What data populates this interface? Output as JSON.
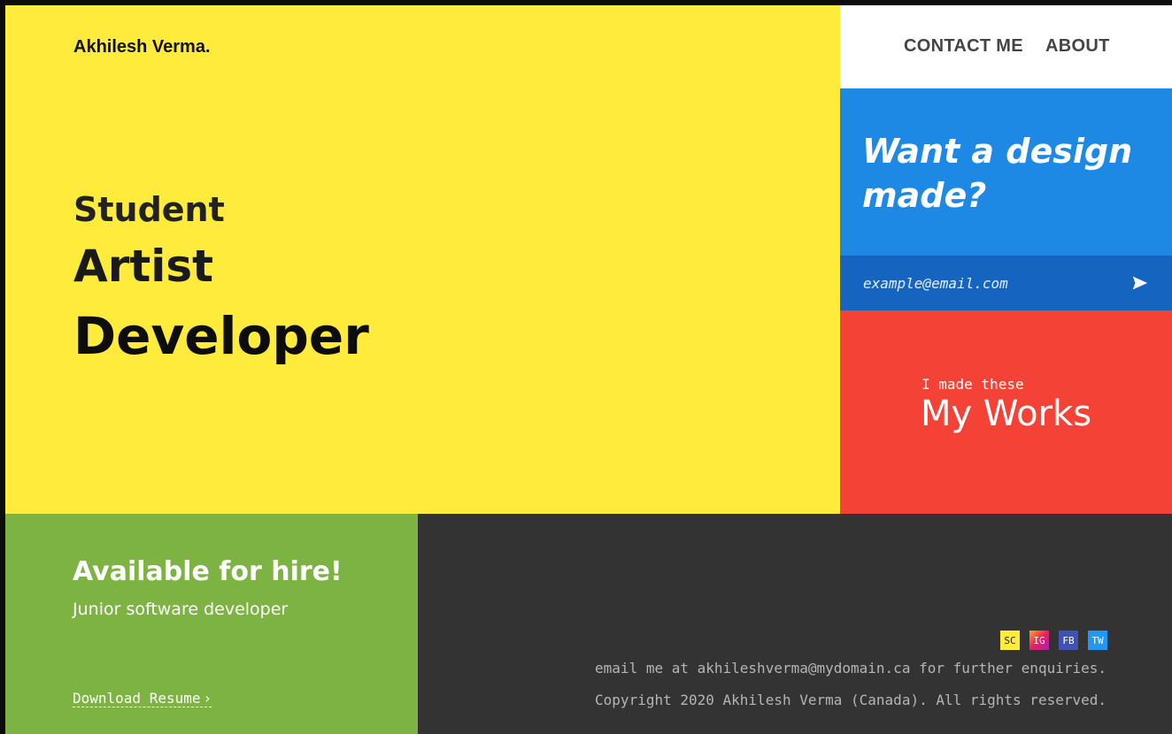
{
  "header": {
    "brand": "Akhilesh Verma.",
    "nav": {
      "contact": "CONTACT ME",
      "about": "ABOUT"
    }
  },
  "hero": {
    "roles": [
      "Student",
      "Artist",
      "Developer"
    ]
  },
  "design_cta": {
    "title": "Want a design made?",
    "email_placeholder": "example@email.com",
    "send_icon": "send-icon"
  },
  "works": {
    "subtitle": "I made these",
    "title": "My Works"
  },
  "hire": {
    "title": "Available for hire!",
    "subtitle": "Junior software developer",
    "resume_link": "Download Resume",
    "resume_icon": "chevron-right-icon"
  },
  "footer": {
    "social": [
      {
        "label": "SC",
        "name": "snapchat-icon",
        "color": "#ffeb3b"
      },
      {
        "label": "IG",
        "name": "instagram-icon",
        "color": "#e91e63"
      },
      {
        "label": "FB",
        "name": "facebook-icon",
        "color": "#3f51b5"
      },
      {
        "label": "TW",
        "name": "twitter-icon",
        "color": "#2196f3"
      }
    ],
    "email_line": "email me at akhileshverma@mydomain.ca for further enquiries.",
    "copyright": "Copyright 2020 Akhilesh Verma (Canada). All rights reserved."
  },
  "colors": {
    "yellow": "#ffeb3b",
    "blue": "#1e88e5",
    "blue_dark": "#1565c0",
    "red": "#f44336",
    "green": "#7cb342",
    "dark": "#333333"
  }
}
